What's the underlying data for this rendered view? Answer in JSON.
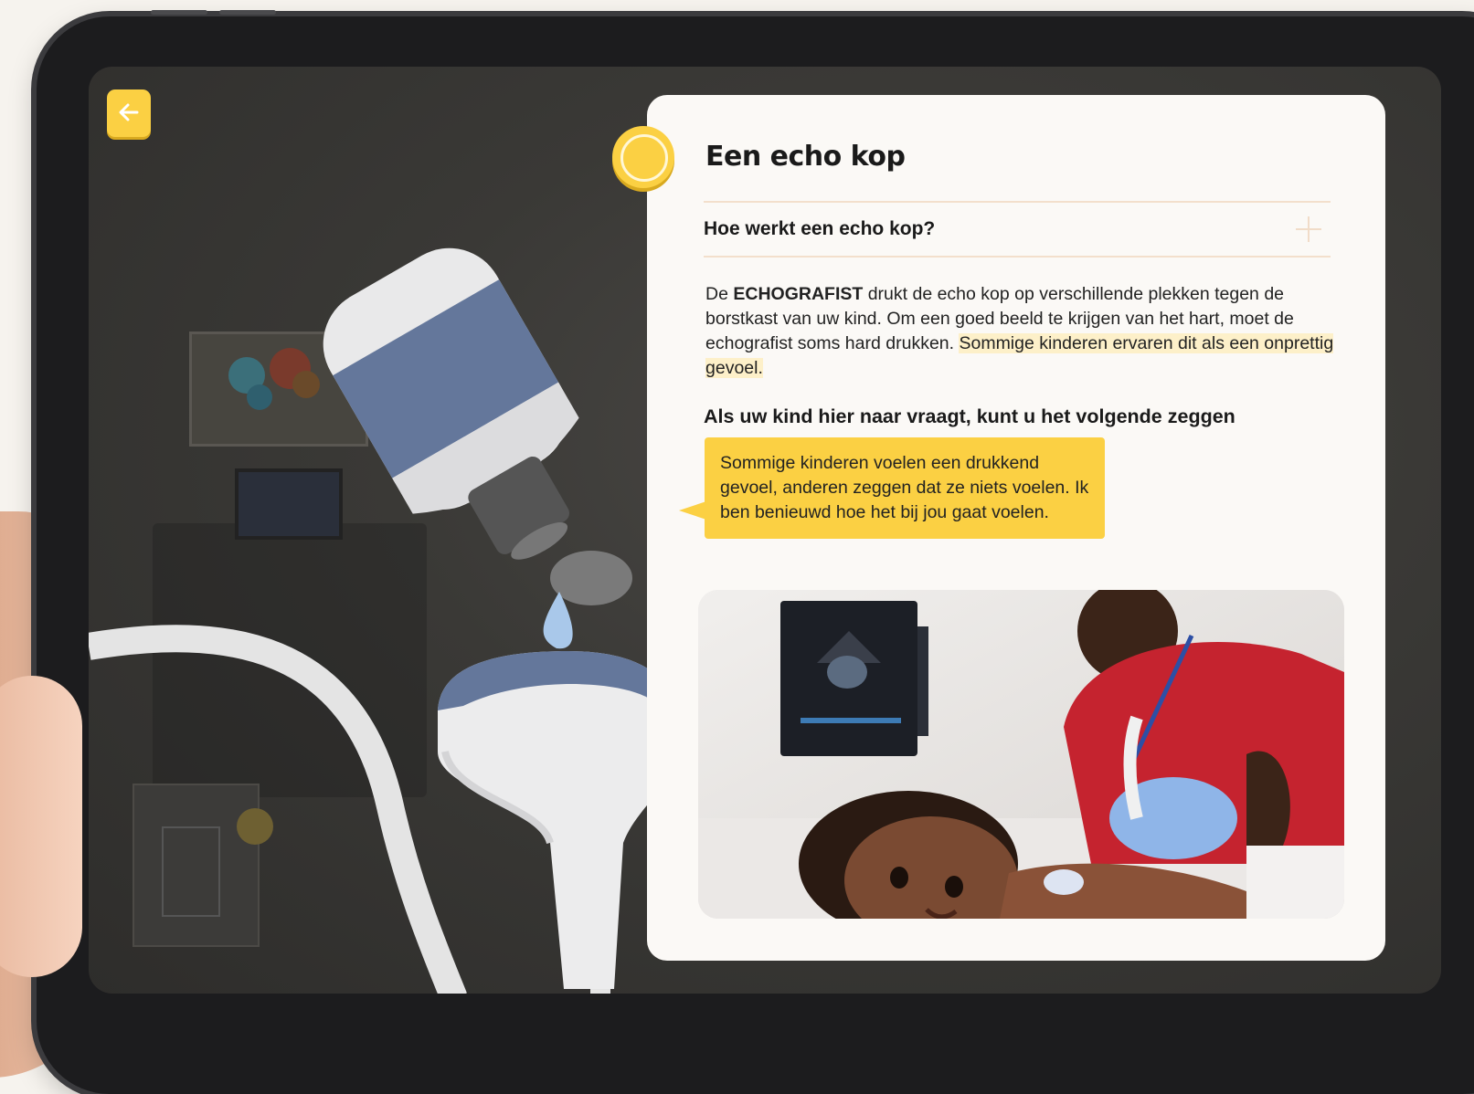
{
  "card": {
    "title": "Een echo kop",
    "accordion_question": "Hoe werkt een echo kop?",
    "body_prefix": "De ",
    "body_bold": "ECHOGRAFIST",
    "body_main": " drukt de echo kop op verschillende plekken tegen de borstkast van uw kind. Om een goed beeld te krijgen van het hart, moet de echografist soms hard drukken. ",
    "body_highlight": "Sommige kinderen ervaren dit als een onprettig gevoel.",
    "say_heading": "Als uw kind hier naar vraagt, kunt u het volgende zeggen",
    "speech_bubble": "Sommige kinderen voelen een drukkend gevoel, anderen zeggen dat ze niets voelen. Ik ben benieuwd hoe het bij jou gaat voelen."
  },
  "icons": {
    "back": "arrow-left-icon",
    "accordion_toggle": "plus-icon",
    "badge": "circle-badge-icon"
  },
  "colors": {
    "accent_yellow": "#fbd043",
    "card_background": "#fbf9f6",
    "highlight": "#fdf0c9",
    "probe_blue": "#64779b"
  }
}
